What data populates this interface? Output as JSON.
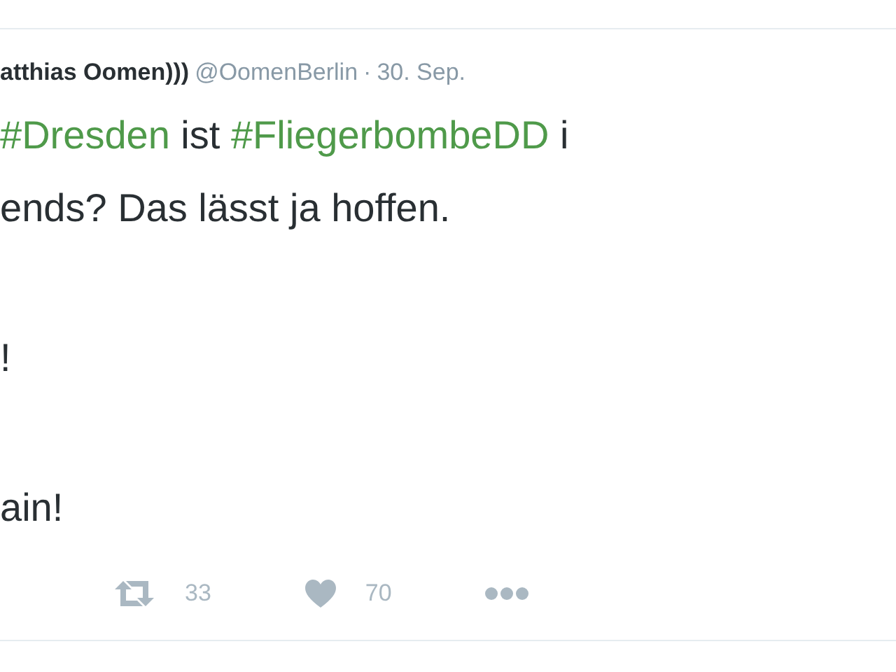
{
  "tweet": {
    "author_name": "atthias Oomen)))",
    "handle": "@OomenBerlin",
    "separator": "·",
    "date": "30. Sep.",
    "paragraphs": [
      [
        [
          {
            "kind": "hashtag",
            "text": "#Dresden"
          },
          {
            "kind": "text",
            "text": " ist "
          },
          {
            "kind": "hashtag",
            "text": "#FliegerbombeDD"
          },
          {
            "kind": "text",
            "text": " i"
          }
        ],
        [
          {
            "kind": "text",
            "text": "ends? Das lässt ja hoffen."
          }
        ]
      ],
      [
        [
          {
            "kind": "text",
            "text": "!"
          }
        ]
      ],
      [
        [
          {
            "kind": "text",
            "text": "ain!"
          }
        ]
      ]
    ],
    "actions": [
      {
        "kind": "retweet",
        "count": "33"
      },
      {
        "kind": "like",
        "count": "70"
      },
      {
        "kind": "more"
      }
    ]
  }
}
